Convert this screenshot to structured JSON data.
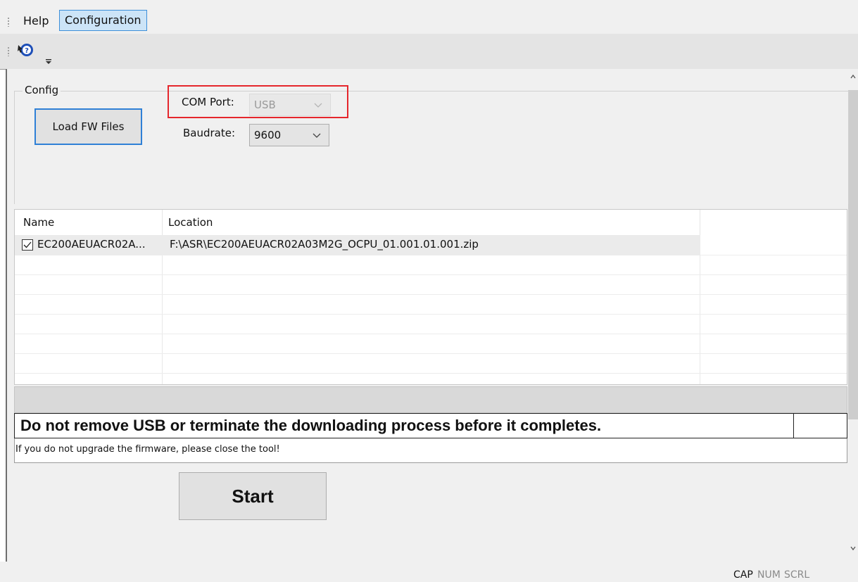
{
  "menubar": {
    "items": [
      {
        "label": "Help"
      },
      {
        "label": "Configuration"
      }
    ]
  },
  "toolbar": {
    "icons": [
      "help-pointer-icon",
      "toolbar-overflow-icon"
    ]
  },
  "config": {
    "group_label": "Config",
    "load_button": "Load FW Files",
    "com_port_label": "COM Port:",
    "com_port_value": "USB",
    "baudrate_label": "Baudrate:",
    "baudrate_value": "9600",
    "highlight_color": "#e5262c"
  },
  "file_list": {
    "columns": [
      "Name",
      "Location"
    ],
    "rows": [
      {
        "checked": true,
        "name": "EC200AEUACR02A...",
        "location": "F:\\ASR\\EC200AEUACR02A03M2G_OCPU_01.001.01.001.zip"
      }
    ]
  },
  "messages": {
    "warning": "Do not remove USB or terminate the downloading process before it completes.",
    "info": "If you do not upgrade the firmware, please close the tool!"
  },
  "start_button": "Start",
  "statusbar": {
    "cap": "CAP",
    "num": "NUM",
    "scrl": "SCRL"
  },
  "colors": {
    "accent": "#2f80d6",
    "menu_active_bg": "#cce4f7"
  }
}
